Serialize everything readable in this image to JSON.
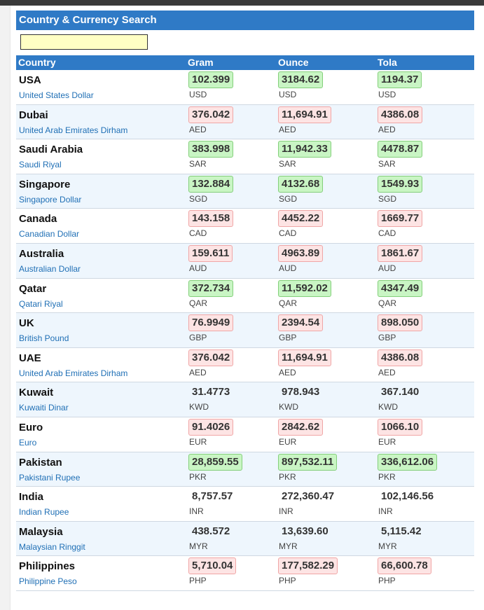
{
  "page": {
    "title": "Country & Currency Search"
  },
  "search": {
    "value": "",
    "placeholder": ""
  },
  "table": {
    "headers": [
      "Country",
      "Gram",
      "Ounce",
      "Tola"
    ],
    "rows": [
      {
        "country": "USA",
        "currency": "United States Dollar",
        "code": "USD",
        "gram": "102.399",
        "ounce": "3184.62",
        "tola": "1194.37",
        "gram_status": "up",
        "ounce_status": "up",
        "tola_status": "up"
      },
      {
        "country": "Dubai",
        "currency": "United Arab Emirates Dirham",
        "code": "AED",
        "gram": "376.042",
        "ounce": "11,694.91",
        "tola": "4386.08",
        "gram_status": "down",
        "ounce_status": "down",
        "tola_status": "down"
      },
      {
        "country": "Saudi Arabia",
        "currency": "Saudi Riyal",
        "code": "SAR",
        "gram": "383.998",
        "ounce": "11,942.33",
        "tola": "4478.87",
        "gram_status": "up",
        "ounce_status": "up",
        "tola_status": "up"
      },
      {
        "country": "Singapore",
        "currency": "Singapore Dollar",
        "code": "SGD",
        "gram": "132.884",
        "ounce": "4132.68",
        "tola": "1549.93",
        "gram_status": "up",
        "ounce_status": "up",
        "tola_status": "up"
      },
      {
        "country": "Canada",
        "currency": "Canadian Dollar",
        "code": "CAD",
        "gram": "143.158",
        "ounce": "4452.22",
        "tola": "1669.77",
        "gram_status": "down",
        "ounce_status": "down",
        "tola_status": "down"
      },
      {
        "country": "Australia",
        "currency": "Australian Dollar",
        "code": "AUD",
        "gram": "159.611",
        "ounce": "4963.89",
        "tola": "1861.67",
        "gram_status": "down",
        "ounce_status": "down",
        "tola_status": "down"
      },
      {
        "country": "Qatar",
        "currency": "Qatari Riyal",
        "code": "QAR",
        "gram": "372.734",
        "ounce": "11,592.02",
        "tola": "4347.49",
        "gram_status": "up",
        "ounce_status": "up",
        "tola_status": "up"
      },
      {
        "country": "UK",
        "currency": "British Pound",
        "code": "GBP",
        "gram": "76.9949",
        "ounce": "2394.54",
        "tola": "898.050",
        "gram_status": "down",
        "ounce_status": "down",
        "tola_status": "down"
      },
      {
        "country": "UAE",
        "currency": "United Arab Emirates Dirham",
        "code": "AED",
        "gram": "376.042",
        "ounce": "11,694.91",
        "tola": "4386.08",
        "gram_status": "down",
        "ounce_status": "down",
        "tola_status": "down"
      },
      {
        "country": "Kuwait",
        "currency": "Kuwaiti Dinar",
        "code": "KWD",
        "gram": "31.4773",
        "ounce": "978.943",
        "tola": "367.140",
        "gram_status": "none",
        "ounce_status": "none",
        "tola_status": "none"
      },
      {
        "country": "Euro",
        "currency": "Euro",
        "code": "EUR",
        "gram": "91.4026",
        "ounce": "2842.62",
        "tola": "1066.10",
        "gram_status": "down",
        "ounce_status": "down",
        "tola_status": "down"
      },
      {
        "country": "Pakistan",
        "currency": "Pakistani Rupee",
        "code": "PKR",
        "gram": "28,859.55",
        "ounce": "897,532.11",
        "tola": "336,612.06",
        "gram_status": "up",
        "ounce_status": "up",
        "tola_status": "up"
      },
      {
        "country": "India",
        "currency": "Indian Rupee",
        "code": "INR",
        "gram": "8,757.57",
        "ounce": "272,360.47",
        "tola": "102,146.56",
        "gram_status": "none",
        "ounce_status": "none",
        "tola_status": "none"
      },
      {
        "country": "Malaysia",
        "currency": "Malaysian Ringgit",
        "code": "MYR",
        "gram": "438.572",
        "ounce": "13,639.60",
        "tola": "5,115.42",
        "gram_status": "none",
        "ounce_status": "none",
        "tola_status": "none"
      },
      {
        "country": "Philippines",
        "currency": "Philippine Peso",
        "code": "PHP",
        "gram": "5,710.04",
        "ounce": "177,582.29",
        "tola": "66,600.78",
        "gram_status": "down",
        "ounce_status": "down",
        "tola_status": "down"
      }
    ]
  },
  "colors": {
    "header": "#2f7ac6",
    "up": "#c9f5c4",
    "down": "#fde4e4",
    "search_bg": "#ffffc4",
    "link": "#1f6fb5"
  }
}
